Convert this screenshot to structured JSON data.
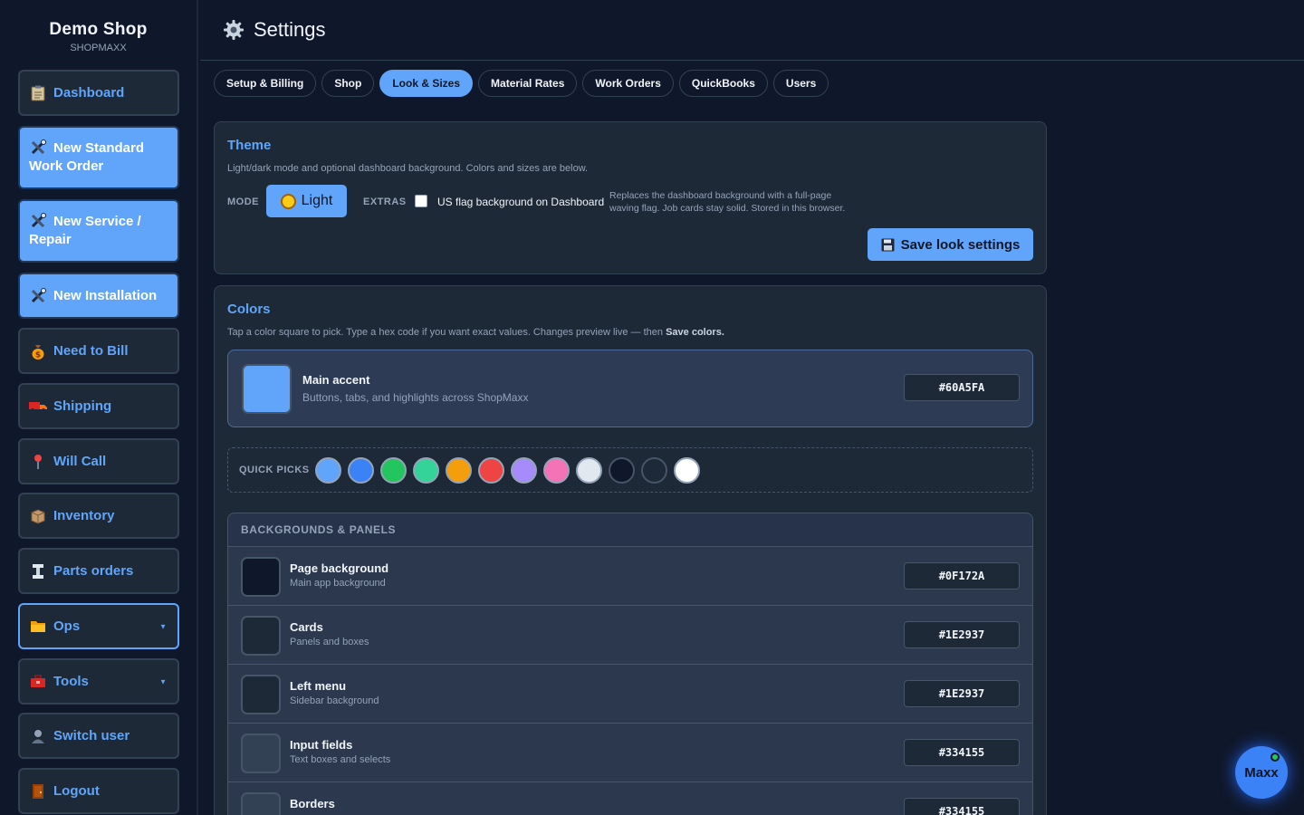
{
  "brand": {
    "name": "Demo Shop",
    "sub": "SHOPMAXX"
  },
  "sidebar": {
    "items": [
      {
        "label": "Dashboard",
        "icon": "clipboard-icon"
      },
      {
        "label": "New Standard Work Order",
        "icon": "tools-icon"
      },
      {
        "label": "New Service / Repair",
        "icon": "tools-icon"
      },
      {
        "label": "New Installation",
        "icon": "tools-icon"
      },
      {
        "label": "Need to Bill",
        "icon": "money-bag-icon"
      },
      {
        "label": "Shipping",
        "icon": "truck-icon"
      },
      {
        "label": "Will Call",
        "icon": "pin-icon"
      },
      {
        "label": "Inventory",
        "icon": "package-icon"
      },
      {
        "label": "Parts orders",
        "icon": "parts-icon"
      },
      {
        "label": "Ops",
        "icon": "folder-icon"
      },
      {
        "label": "Tools",
        "icon": "toolbox-icon"
      },
      {
        "label": "Switch user",
        "icon": "user-icon"
      },
      {
        "label": "Logout",
        "icon": "door-icon"
      }
    ]
  },
  "header": {
    "title": "Settings",
    "icon": "gear-icon"
  },
  "tabs": [
    "Setup & Billing",
    "Shop",
    "Look & Sizes",
    "Material Rates",
    "Work Orders",
    "QuickBooks",
    "Users"
  ],
  "active_tab": "Look & Sizes",
  "theme": {
    "title": "Theme",
    "desc": "Light/dark mode and optional dashboard background. Colors and sizes are below.",
    "mode_label": "MODE",
    "mode_value": "Light",
    "extras_label": "EXTRAS",
    "flag_label": "US flag background on Dashboard",
    "flag_checked": false,
    "flag_note": "Replaces the dashboard background with a full-page waving flag. Job cards stay solid. Stored in this browser.",
    "save_label": "Save look settings"
  },
  "colors": {
    "title": "Colors",
    "desc_prefix": "Tap a color square to pick. Type a hex code if you want exact values. Changes preview live — then ",
    "desc_bold": "Save colors.",
    "main_accent": {
      "name": "Main accent",
      "sub": "Buttons, tabs, and highlights across ShopMaxx",
      "hex": "#60A5FA"
    },
    "quick_picks_label": "QUICK PICKS",
    "quick_picks": [
      "#60a5fa",
      "#3b82f6",
      "#22c55e",
      "#34d399",
      "#f59e0b",
      "#ef4444",
      "#a78bfa",
      "#f472b6",
      "#e2e8f0",
      "#0f172a",
      "#1e2937",
      "#ffffff"
    ],
    "bp_title": "BACKGROUNDS & PANELS",
    "rows": [
      {
        "name": "Page background",
        "sub": "Main app background",
        "hex": "#0F172A"
      },
      {
        "name": "Cards",
        "sub": "Panels and boxes",
        "hex": "#1E2937"
      },
      {
        "name": "Left menu",
        "sub": "Sidebar background",
        "hex": "#1E2937"
      },
      {
        "name": "Input fields",
        "sub": "Text boxes and selects",
        "hex": "#334155"
      },
      {
        "name": "Borders",
        "sub": "",
        "hex": "#334155"
      }
    ]
  },
  "assistant": {
    "label": "Maxx",
    "status": "online"
  }
}
